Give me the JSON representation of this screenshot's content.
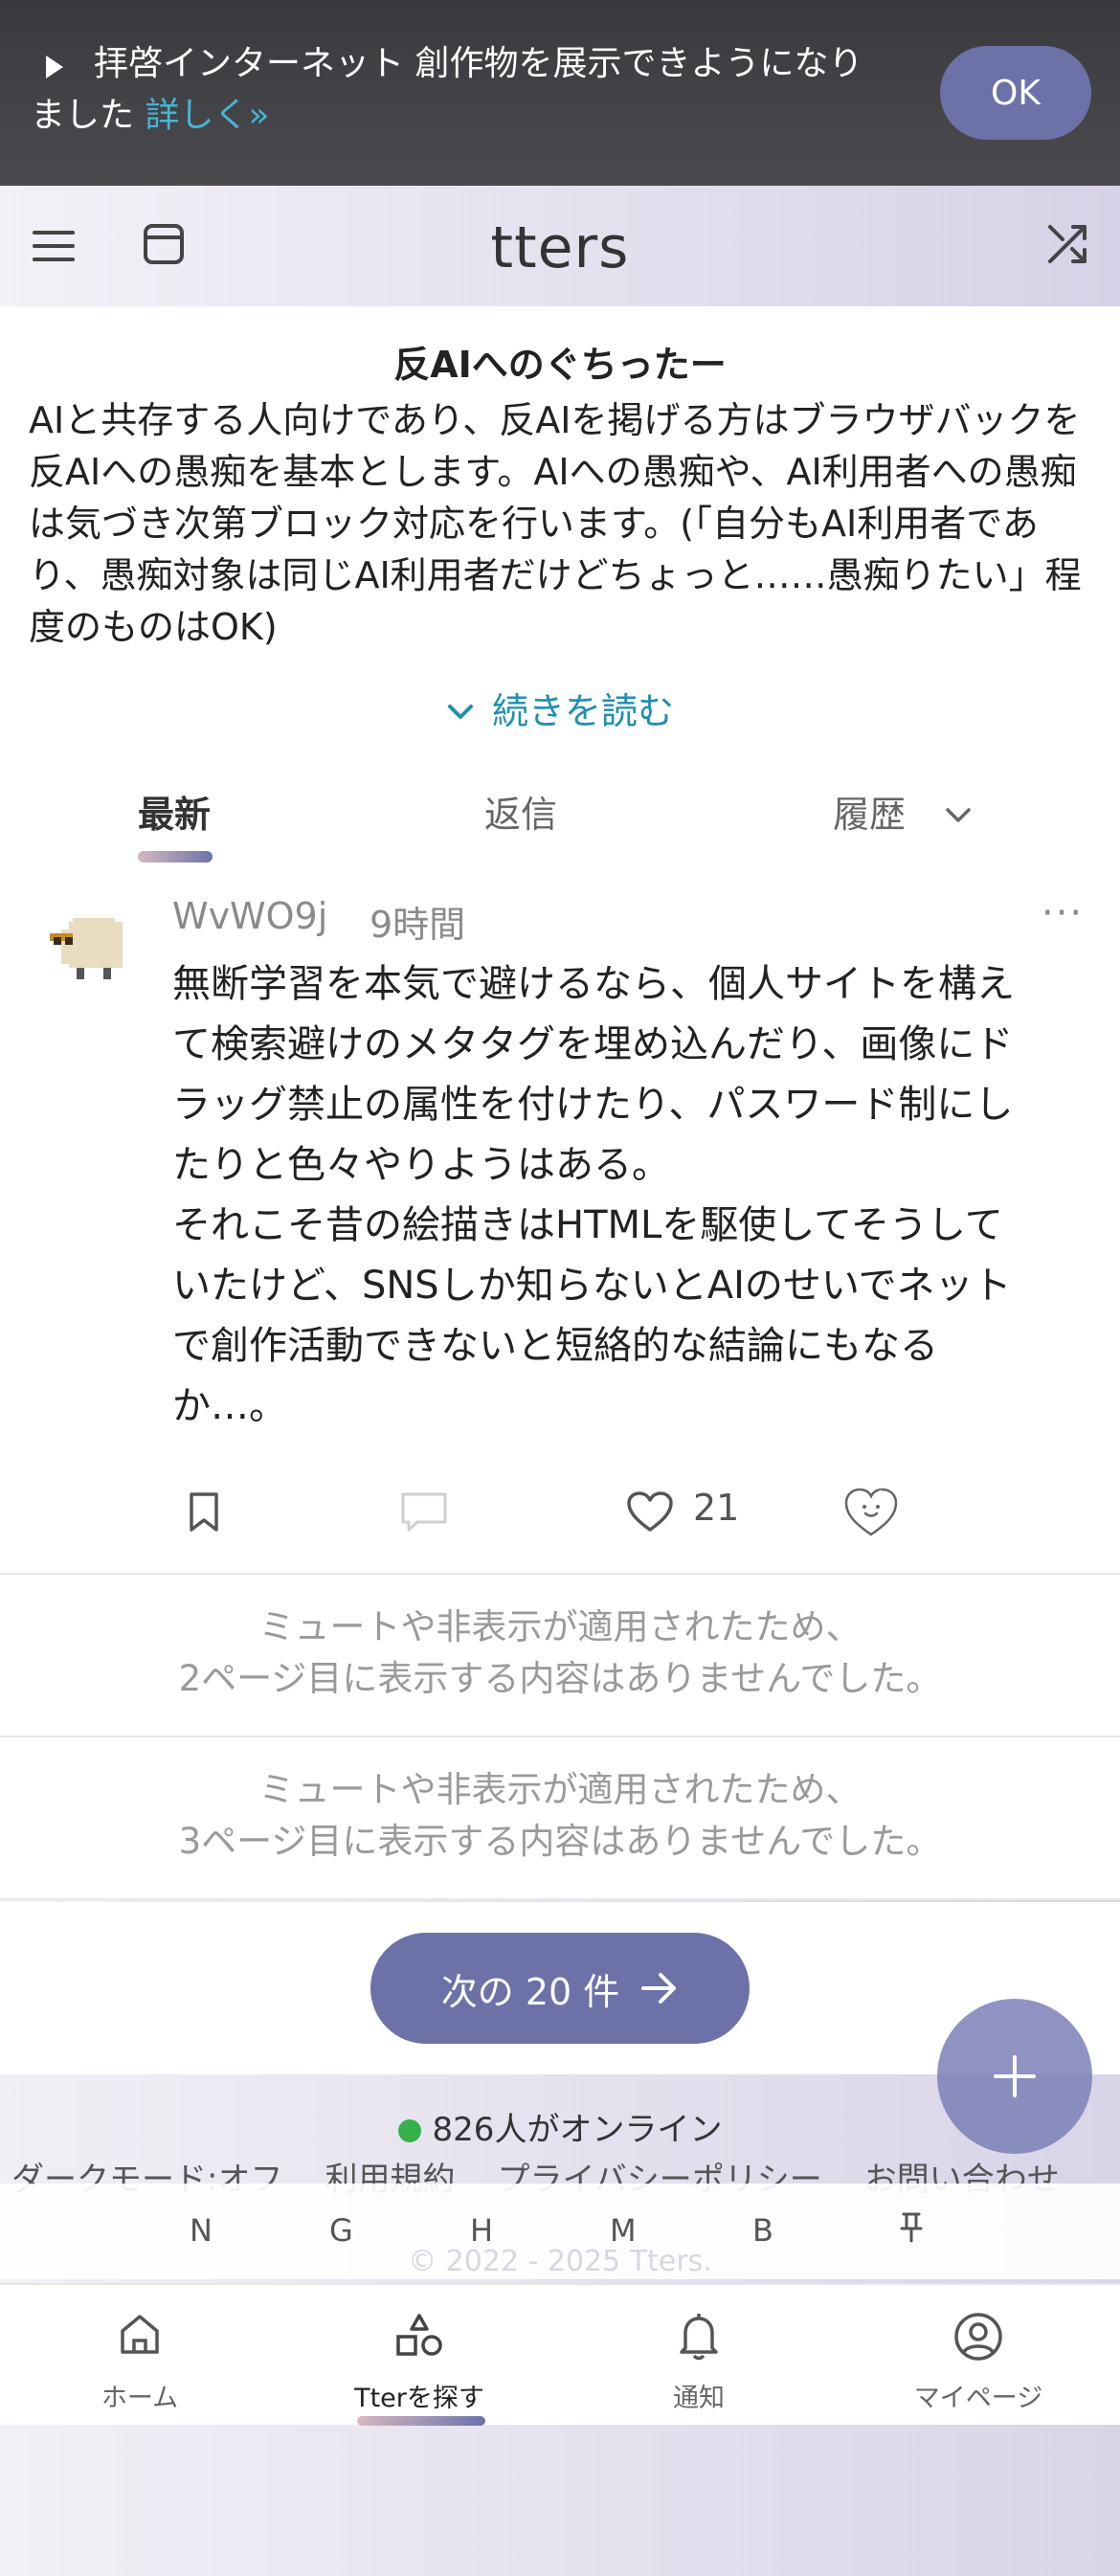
{
  "announcement": {
    "text": "拝啓インターネット 創作物を展示できようになりました",
    "link": "詳しく»",
    "ok_label": "OK"
  },
  "header": {
    "title": "tters"
  },
  "description": {
    "heading": "反AIへのぐちったー",
    "body": "AIと共存する人向けであり、反AIを掲げる方はブラウザバックを\n反AIへの愚痴を基本とします。AIへの愚痴や、AI利用者への愚痴は気づき次第ブロック対応を行います。(「自分もAI利用者であり、愚痴対象は同じAI利用者だけどちょっと……愚痴りたい」程度のものはOK)",
    "read_more": "続きを読む"
  },
  "tabs": [
    {
      "label": "最新"
    },
    {
      "label": "返信"
    },
    {
      "label": "履歴"
    }
  ],
  "post": {
    "author": "WvWO9j",
    "time": "9時間",
    "content": "無断学習を本気で避けるなら、個人サイトを構えて検索避けのメタタグを埋め込んだり、画像にドラッグ禁止の属性を付けたり、パスワード制にしたりと色々やりようはある。\nそれこそ昔の絵描きはHTMLを駆使してそうしていたけど、SNSしか知らないとAIのせいでネットで創作活動できないと短絡的な結論にもなるか…。",
    "likes": "21"
  },
  "empty_pages": [
    {
      "line1": "ミュートや非表示が適用されたため、",
      "line2": "2ページ目に表示する内容はありませんでした。"
    },
    {
      "line1": "ミュートや非表示が適用されたため、",
      "line2": "3ページ目に表示する内容はありませんでした。"
    }
  ],
  "pagination": {
    "next_label": "次の 20 件"
  },
  "footer": {
    "online": "826人がオンライン",
    "links": [
      "ダークモード:オフ",
      "利用規約",
      "プライバシーポリシー",
      "お問い合わせ"
    ],
    "quick_keys": [
      "N",
      "G",
      "H",
      "M",
      "B"
    ],
    "copyright": "© 2022 - 2025 Tters."
  },
  "bottom_nav": [
    {
      "label": "ホーム"
    },
    {
      "label": "Tterを探す"
    },
    {
      "label": "通知"
    },
    {
      "label": "マイページ"
    }
  ],
  "colors": {
    "accent": "#6c72a8",
    "link": "#1f8fb0",
    "online_dot": "#35b04a",
    "announcement_bg": "#3a3a3e"
  },
  "icons": [
    "menu-icon",
    "window-icon",
    "shuffle-icon",
    "chevron-down-icon",
    "bookmark-icon",
    "comment-icon",
    "heart-icon",
    "reaction-icon",
    "arrow-right-icon",
    "plus-icon",
    "pin-icon",
    "home-icon",
    "shapes-icon",
    "bell-icon",
    "user-icon"
  ]
}
